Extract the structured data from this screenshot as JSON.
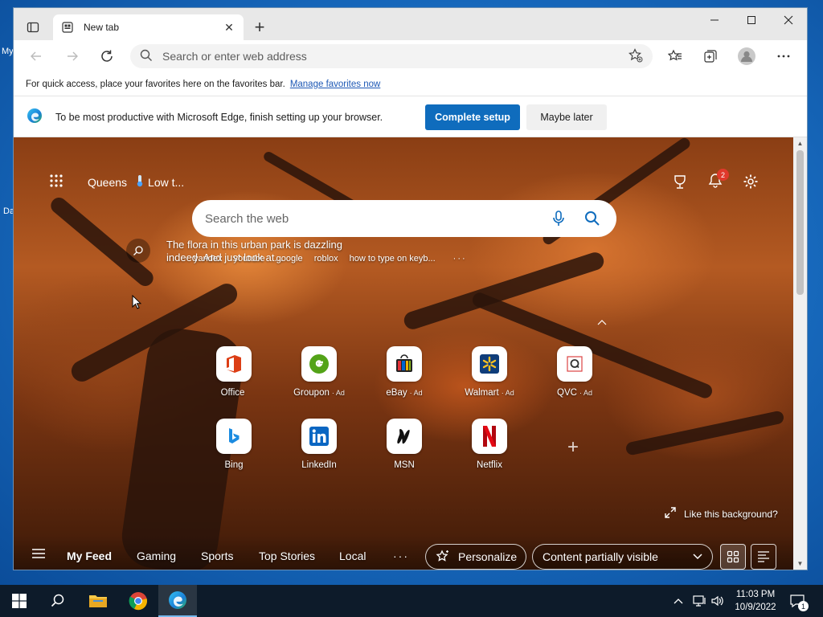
{
  "desktop": {
    "label_1": "My",
    "label_2": "Da"
  },
  "browser": {
    "tab": {
      "title": "New tab"
    },
    "address_placeholder": "Search or enter web address",
    "favbar": {
      "text": "For quick access, place your favorites here on the favorites bar.",
      "link": "Manage favorites now"
    },
    "infobar": {
      "text": "To be most productive with Microsoft Edge, finish setting up your browser.",
      "primary_button": "Complete setup",
      "secondary_button": "Maybe later"
    }
  },
  "ntp": {
    "location": "Queens",
    "weather": "Low t...",
    "notification_count": "2",
    "search_placeholder": "Search the web",
    "caption": "The flora in this urban park is dazzling indeed. And just look at...",
    "trending": [
      "yandex",
      "youtube",
      "google",
      "roblox",
      "how to type on keyb..."
    ],
    "more": "···",
    "tiles_row1": [
      {
        "label": "Office",
        "ad": ""
      },
      {
        "label": "Groupon",
        "ad": "Ad"
      },
      {
        "label": "eBay",
        "ad": "Ad"
      },
      {
        "label": "Walmart",
        "ad": "Ad"
      },
      {
        "label": "QVC",
        "ad": "Ad"
      }
    ],
    "tiles_row2": [
      {
        "label": "Bing",
        "ad": ""
      },
      {
        "label": "LinkedIn",
        "ad": ""
      },
      {
        "label": "MSN",
        "ad": ""
      },
      {
        "label": "Netflix",
        "ad": ""
      }
    ],
    "like_background": "Like this background?",
    "feed": {
      "tabs": [
        "My Feed",
        "Gaming",
        "Sports",
        "Top Stories",
        "Local"
      ],
      "more": "···",
      "personalize": "Personalize",
      "content_visibility": "Content partially visible"
    }
  },
  "taskbar": {
    "time": "11:03 PM",
    "date": "10/9/2022",
    "notification_count": "1"
  },
  "colors": {
    "accent": "#0f6cbd",
    "link": "#1d58b5",
    "badge": "#e0392b",
    "taskbar": "#0d1b2a"
  }
}
